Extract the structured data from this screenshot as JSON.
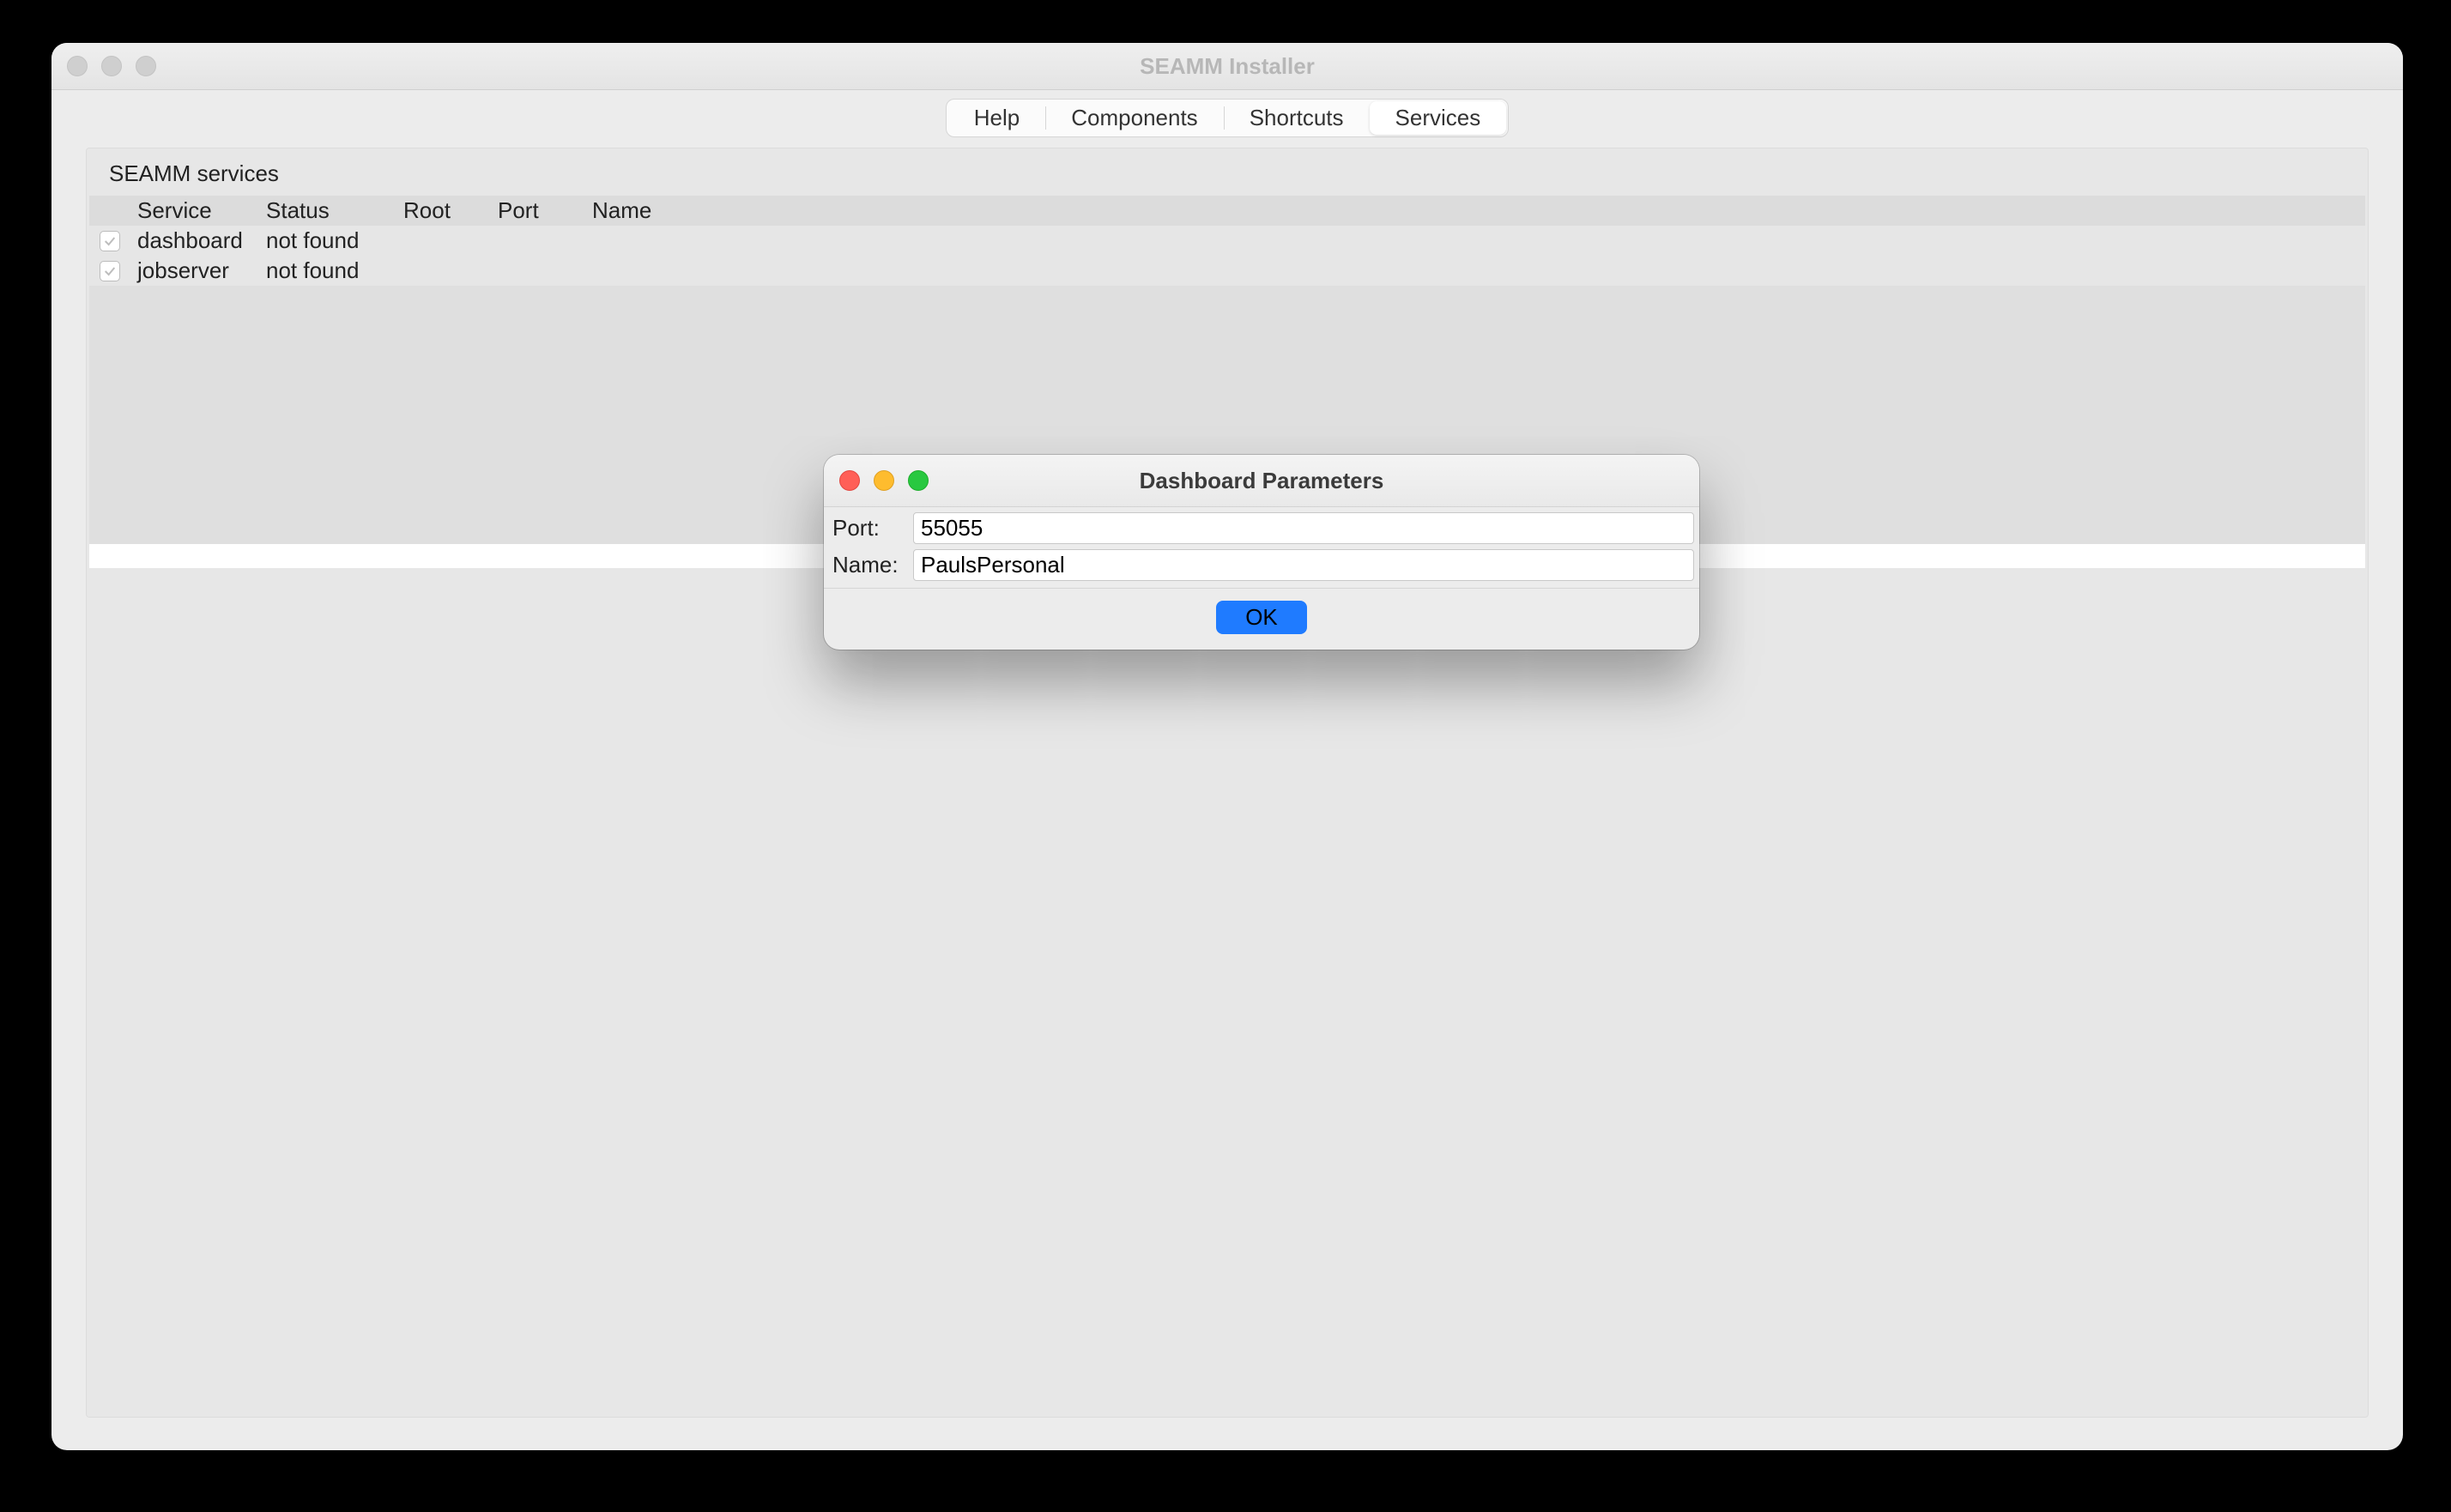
{
  "main_window": {
    "title": "SEAMM Installer",
    "tabs": {
      "help": "Help",
      "components": "Components",
      "shortcuts": "Shortcuts",
      "services": "Services",
      "active": "services"
    },
    "panel": {
      "title": "SEAMM services",
      "columns": {
        "service": "Service",
        "status": "Status",
        "root": "Root",
        "port": "Port",
        "name": "Name"
      },
      "rows": [
        {
          "checked": true,
          "service": "dashboard",
          "status": "not found",
          "root": "",
          "port": "",
          "name": ""
        },
        {
          "checked": true,
          "service": "jobserver",
          "status": "not found",
          "root": "",
          "port": "",
          "name": ""
        }
      ]
    }
  },
  "dialog": {
    "title": "Dashboard Parameters",
    "port_label": "Port:",
    "port_value": "55055",
    "name_label": "Name:",
    "name_value": "PaulsPersonal",
    "ok_label": "OK"
  }
}
